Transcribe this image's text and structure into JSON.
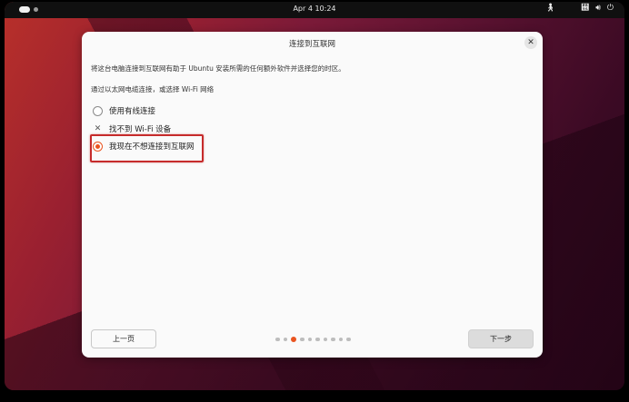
{
  "topbar": {
    "clock": "Apr 4  10:24",
    "tray": {
      "accessibility_icon": "accessibility-icon",
      "network_icon": "network-icon",
      "volume_icon": "volume-icon",
      "power_icon": "power-icon"
    }
  },
  "dialog": {
    "title": "连接到互联网",
    "close_icon": "close-icon",
    "description": "将这台电脑连接到互联网有助于 Ubuntu 安装所需的任何额外软件并选择您的时区。",
    "subtitle": "通过以太网电缆连接，或选择 Wi-Fi 网络",
    "options": [
      {
        "label": "使用有线连接",
        "checked": false
      },
      {
        "label": "找不到 Wi-Fi 设备",
        "disabled": true
      },
      {
        "label": "我现在不想连接到互联网",
        "checked": true
      }
    ],
    "pager": {
      "total": 10,
      "active_index": 2
    },
    "prev_button": "上一页",
    "next_button": "下一步"
  },
  "colors": {
    "accent": "#e95420",
    "highlight_box": "#c62b2b"
  }
}
